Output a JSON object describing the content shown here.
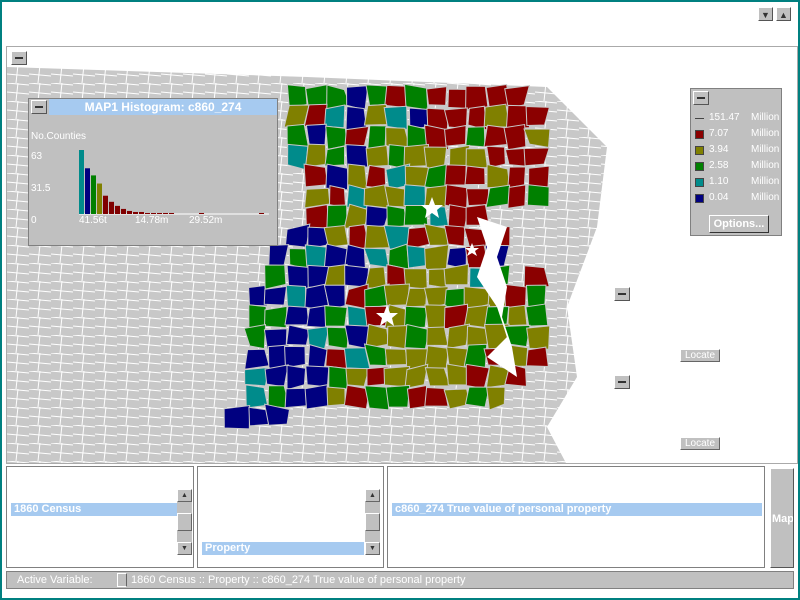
{
  "window": {
    "minimize_glyph": "▼",
    "maximize_glyph": "▲"
  },
  "histogram": {
    "title": "MAP1 Histogram: c860_274",
    "y_label": "No.Counties",
    "y_ticks": [
      "63",
      "31.5",
      "0"
    ],
    "x_ticks": [
      "41.56t",
      "14.78m",
      "29.52m"
    ]
  },
  "chart_data": {
    "type": "bar",
    "title": "MAP1 Histogram: c860_274",
    "ylabel": "No.Counties",
    "ylim": [
      0,
      63
    ],
    "x_ticks": [
      "41.56t",
      "14.78m",
      "29.52m"
    ],
    "values": [
      63,
      45,
      38,
      30,
      18,
      12,
      8,
      5,
      3,
      2,
      2,
      1,
      1,
      1,
      1,
      1,
      0,
      0,
      0,
      0,
      1,
      0,
      0,
      0,
      0,
      0,
      0,
      0,
      0,
      0,
      1
    ],
    "bar_colors": [
      "#008b8b",
      "#000080",
      "#008000",
      "#808000",
      "#800000"
    ]
  },
  "legend": {
    "items": [
      {
        "value": "151.47",
        "unit": "Million",
        "color": "#c0c0c0"
      },
      {
        "value": "7.07",
        "unit": "Million",
        "color": "#8b0000"
      },
      {
        "value": "3.94",
        "unit": "Million",
        "color": "#808000"
      },
      {
        "value": "2.58",
        "unit": "Million",
        "color": "#008000"
      },
      {
        "value": "1.10",
        "unit": "Million",
        "color": "#008b8b"
      },
      {
        "value": "0.04",
        "unit": "Million",
        "color": "#000080"
      }
    ],
    "options_label": "Options..."
  },
  "locate_buttons": [
    "Locate",
    "Locate"
  ],
  "panels": {
    "dataset": {
      "selected": "1860 Census"
    },
    "category": {
      "selected": "Property"
    },
    "variable": {
      "selected": "c860_274 True value of personal property"
    },
    "map_button": "Map"
  },
  "scroll_glyphs": {
    "up": "▲",
    "down": "▼"
  },
  "status": {
    "label": "Active Variable:",
    "value": "1860 Census :: Property :: c860_274 True value of personal property"
  },
  "colors": {
    "class1": "#000080",
    "class2": "#008b8b",
    "class3": "#008000",
    "class4": "#808000",
    "class5": "#8b0000",
    "background_counties": "#c8c8c8"
  }
}
